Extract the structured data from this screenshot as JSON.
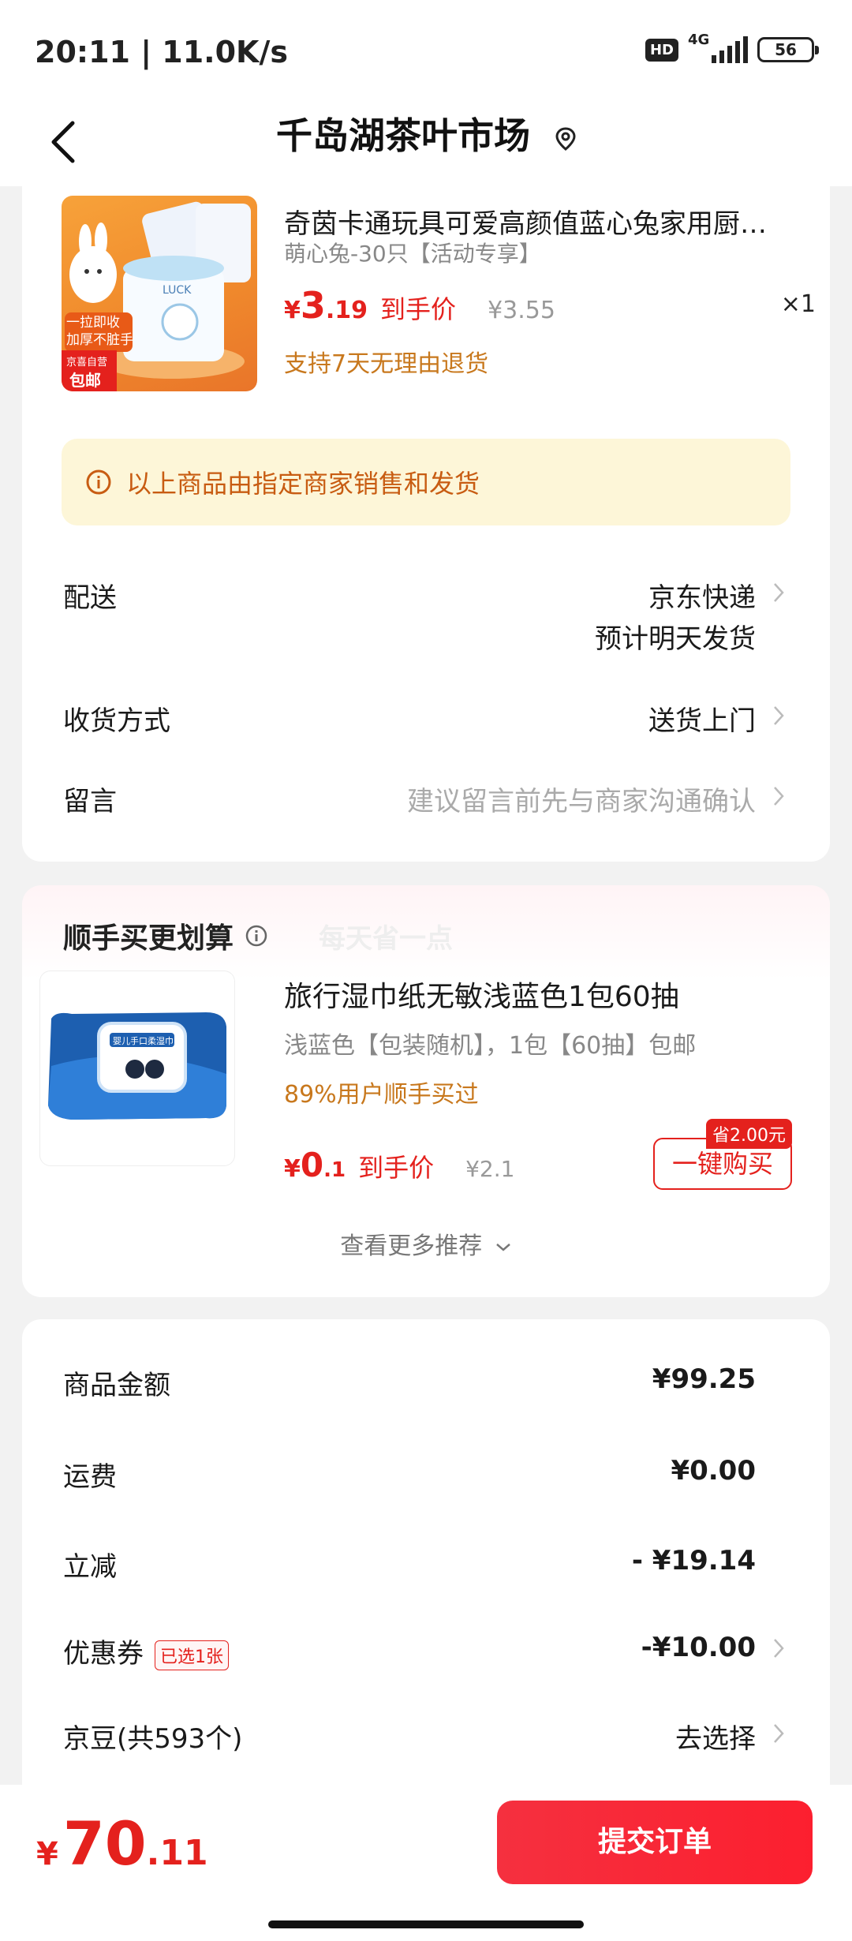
{
  "status": {
    "time": "20:11 | 11.0K/s",
    "hd": "HD",
    "network": "4G",
    "battery": "56"
  },
  "nav": {
    "title": "千岛湖茶叶市场"
  },
  "product1": {
    "title": "奇茵卡通玩具可爱高颜值蓝心兔家用厨房纸巾",
    "spec": "萌心兔-30只【活动专享】",
    "price_symbol": "¥",
    "price_int": "3",
    "price_dec": ".19",
    "price_tag": "到手价",
    "orig_price": "¥3.55",
    "qty": "×1",
    "return_note": "支持7天无理由退货",
    "image_text": {
      "banner": "一拉即收\n加厚不脏手",
      "jd": "京喜自营",
      "ship": "包邮",
      "luck": "LUCK"
    }
  },
  "notice": {
    "text": "以上商品由指定商家销售和发货"
  },
  "delivery": {
    "label": "配送",
    "value": "京东快递",
    "sub": "预计明天发货"
  },
  "receive": {
    "label": "收货方式",
    "value": "送货上门"
  },
  "message": {
    "label": "留言",
    "placeholder": "建议留言前先与商家沟通确认"
  },
  "recommend": {
    "title": "顺手买更划算",
    "subtitle": "每天省一点",
    "product": {
      "title": "旅行湿巾纸无敏浅蓝色1包60抽",
      "spec": "浅蓝色【包装随机】，1包【60抽】包邮",
      "bought": "89%用户顺手买过",
      "price_symbol": "¥",
      "price_int": "0",
      "price_dec": ".1",
      "price_tag": "到手价",
      "orig_price": "¥2.1",
      "save_badge": "省2.00元",
      "buy_label": "一键购买",
      "image_text": "婴儿手口柔湿巾"
    },
    "more": "查看更多推荐"
  },
  "summary": {
    "goods": {
      "label": "商品金额",
      "value": "¥99.25"
    },
    "freight": {
      "label": "运费",
      "value": "¥0.00"
    },
    "discount": {
      "label": "立减",
      "value": "- ¥19.14"
    },
    "coupon": {
      "label": "优惠券",
      "tag": "已选1张",
      "value": "-¥10.00"
    },
    "jingdou": {
      "label": "京豆(共593个)",
      "value": "去选择"
    }
  },
  "footer": {
    "total_symbol": "¥",
    "total_int": "70",
    "total_dec": ".11",
    "submit": "提交订单"
  },
  "colors": {
    "accent": "#e4211d",
    "orange": "#c8781d",
    "notice_bg": "#fdf6d8"
  }
}
